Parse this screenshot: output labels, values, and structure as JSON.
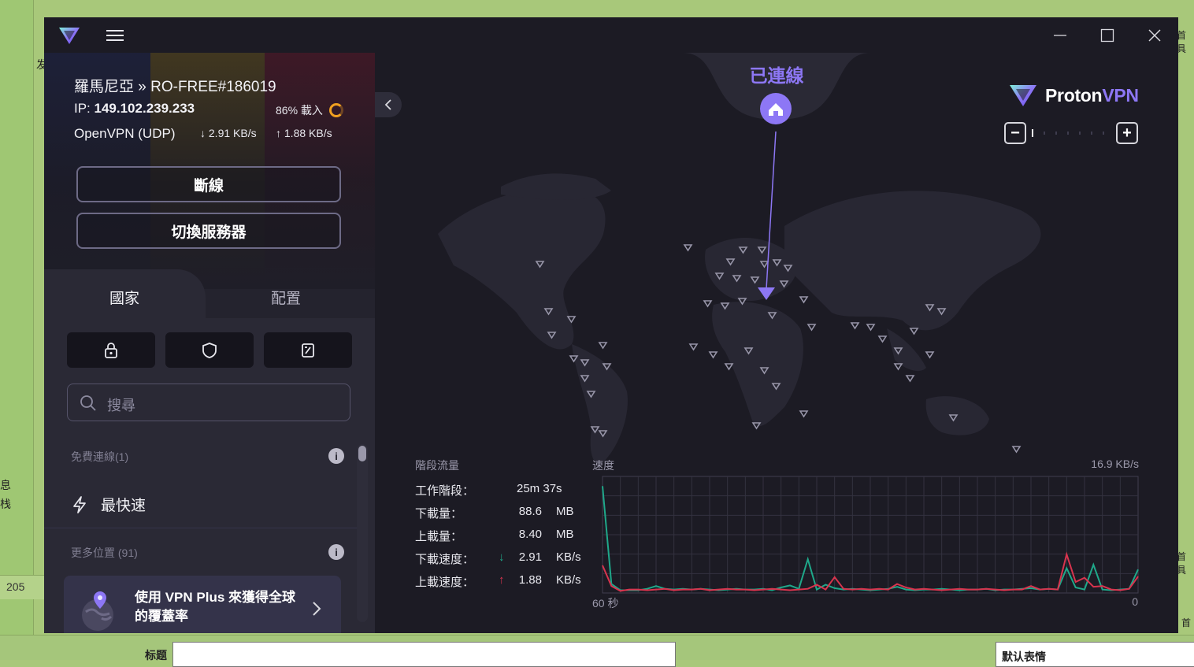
{
  "app": {
    "title": "Proton VPN",
    "brand_proton": "Proton",
    "brand_vpn": "VPN"
  },
  "window_controls": {
    "minimize": "—",
    "maximize": "☐",
    "close": "✕"
  },
  "connection": {
    "server": "羅馬尼亞 » RO-FREE#186019",
    "ip_label": "IP: ",
    "ip": "149.102.239.233",
    "load": "86% 載入",
    "protocol": "OpenVPN (UDP)",
    "down_speed": "↓ 2.91 KB/s",
    "up_speed": "↑ 1.88 KB/s",
    "disconnect_label": "斷線",
    "switch_label": "切換服務器"
  },
  "tabs": [
    {
      "label": "國家",
      "active": true
    },
    {
      "label": "配置",
      "active": false
    }
  ],
  "filters": [
    {
      "icon": "lock-icon"
    },
    {
      "icon": "shield-icon"
    },
    {
      "icon": "streaming-icon"
    }
  ],
  "search": {
    "placeholder": "搜尋"
  },
  "list": {
    "free_section": "免費連線(1)",
    "fastest": "最快速",
    "more_section": "更多位置 (91)",
    "promo": "使用 VPN Plus 來獲得全球的覆蓋率"
  },
  "map": {
    "status": "已連線",
    "zoom_minus": "−",
    "zoom_plus": "+"
  },
  "stats": {
    "title": "階段流量",
    "rows": [
      {
        "label": "工作階段：",
        "arrow": "",
        "value": "25m 37s",
        "unit": ""
      },
      {
        "label": "下載量：",
        "arrow": "",
        "value": "88.6",
        "unit": "MB"
      },
      {
        "label": "上載量：",
        "arrow": "",
        "value": "8.40",
        "unit": "MB"
      },
      {
        "label": "下載速度：",
        "arrow": "↓",
        "value": "2.91",
        "unit": "KB/s"
      },
      {
        "label": "上載速度：",
        "arrow": "↑",
        "value": "1.88",
        "unit": "KB/s"
      }
    ]
  },
  "chart_data": {
    "type": "line",
    "title": "速度",
    "ymax_label": "16.9  KB/s",
    "x_start_label": "60 秒",
    "x_end_label": "0",
    "ylim": [
      0,
      16.9
    ],
    "x": [
      0,
      1,
      2,
      3,
      4,
      5,
      6,
      7,
      8,
      9,
      10,
      11,
      12,
      13,
      14,
      15,
      16,
      17,
      18,
      19,
      20,
      21,
      22,
      23,
      24,
      25,
      26,
      27,
      28,
      29,
      30,
      31,
      32,
      33,
      34,
      35,
      36,
      37,
      38,
      39,
      40,
      41,
      42,
      43,
      44,
      45,
      46,
      47,
      48,
      49,
      50,
      51,
      52,
      53,
      54,
      55,
      56,
      57,
      58,
      59,
      60
    ],
    "series": [
      {
        "name": "download",
        "color": "#1fa88a",
        "values": [
          15.5,
          1.3,
          0.4,
          0.4,
          0.4,
          0.6,
          1.0,
          0.6,
          0.5,
          0.6,
          0.5,
          0.6,
          0.5,
          0.4,
          0.5,
          0.6,
          0.5,
          0.5,
          0.6,
          0.4,
          0.8,
          1.1,
          0.6,
          4.9,
          0.5,
          1.2,
          0.7,
          0.5,
          0.6,
          0.5,
          0.4,
          0.5,
          0.6,
          0.9,
          0.5,
          0.4,
          0.5,
          0.5,
          0.6,
          0.5,
          0.4,
          0.5,
          0.5,
          0.6,
          0.4,
          0.5,
          0.5,
          0.6,
          0.7,
          0.5,
          0.6,
          0.5,
          3.6,
          0.8,
          0.5,
          4.1,
          0.5,
          0.4,
          0.5,
          0.6,
          3.4
        ]
      },
      {
        "name": "upload",
        "color": "#d8344e",
        "values": [
          4.0,
          1.0,
          0.3,
          0.5,
          0.5,
          0.4,
          0.5,
          0.6,
          0.4,
          0.5,
          0.5,
          0.6,
          0.4,
          0.5,
          0.6,
          0.5,
          0.5,
          0.4,
          0.5,
          0.6,
          0.5,
          0.4,
          0.5,
          0.6,
          1.2,
          0.5,
          2.3,
          0.6,
          0.5,
          0.6,
          0.5,
          0.6,
          0.5,
          1.3,
          0.8,
          0.5,
          0.6,
          0.5,
          0.4,
          0.5,
          0.6,
          0.5,
          0.5,
          0.6,
          0.5,
          0.4,
          0.5,
          0.5,
          1.0,
          0.5,
          0.6,
          0.5,
          5.6,
          1.6,
          2.2,
          0.9,
          1.0,
          0.5,
          0.4,
          0.6,
          2.4
        ]
      }
    ]
  },
  "background": {
    "left_num": "205",
    "bottom_label": "标题",
    "bottom_right_label": "默认表情",
    "left_chars": [
      "发",
      "息",
      "栈"
    ],
    "right_chars": [
      "首具",
      "首具",
      "首"
    ]
  }
}
